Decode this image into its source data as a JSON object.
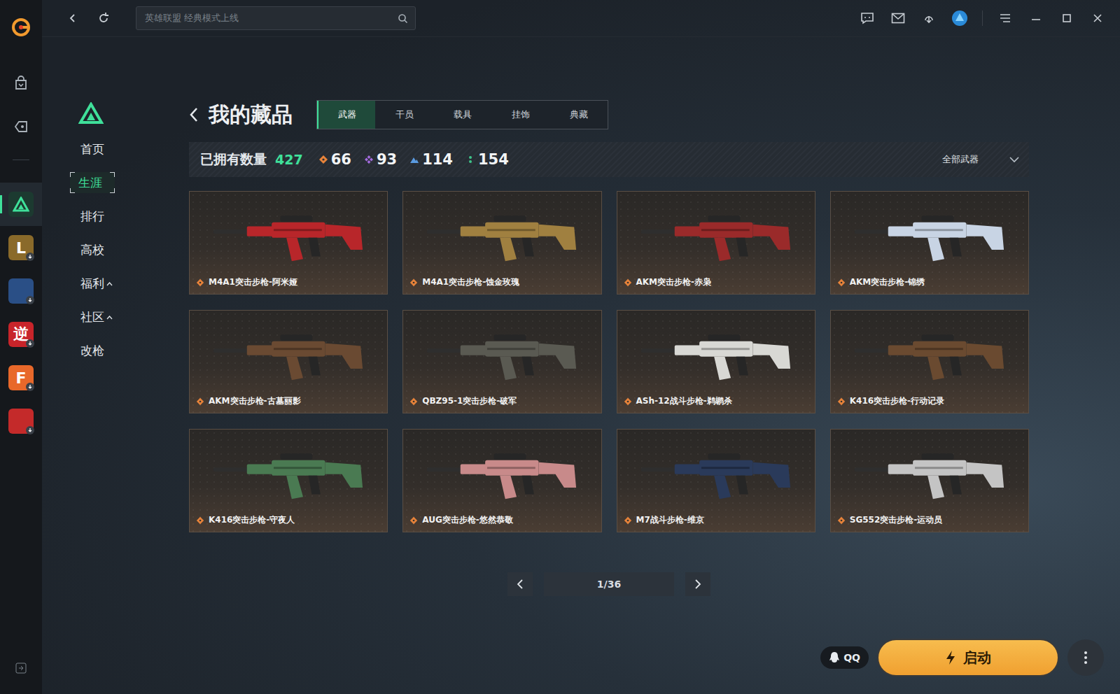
{
  "topbar": {
    "search_placeholder": "英雄联盟 经典模式上线"
  },
  "rail": {
    "games": [
      {
        "kind": "delta",
        "glyph": "",
        "color": "#1c3a30",
        "selected": true,
        "download": false
      },
      {
        "kind": "tile",
        "glyph": "L",
        "color": "#8a6a2a",
        "selected": false,
        "download": true
      },
      {
        "kind": "tile",
        "glyph": "",
        "color": "#2a4f86",
        "selected": false,
        "download": true
      },
      {
        "kind": "tile",
        "glyph": "逆",
        "color": "#c8242a",
        "selected": false,
        "download": true
      },
      {
        "kind": "tile",
        "glyph": "F",
        "color": "#e8682a",
        "selected": false,
        "download": true
      },
      {
        "kind": "tile",
        "glyph": "",
        "color": "#c42a2a",
        "selected": false,
        "download": true
      }
    ]
  },
  "sidebar": {
    "items": [
      {
        "label": "首页",
        "selected": false,
        "submenu": false
      },
      {
        "label": "生涯",
        "selected": true,
        "submenu": false
      },
      {
        "label": "排行",
        "selected": false,
        "submenu": false
      },
      {
        "label": "高校",
        "selected": false,
        "submenu": false
      },
      {
        "label": "福利",
        "selected": false,
        "submenu": true
      },
      {
        "label": "社区",
        "selected": false,
        "submenu": true
      },
      {
        "label": "改枪",
        "selected": false,
        "submenu": false
      }
    ]
  },
  "page": {
    "title": "我的藏品",
    "tabs": [
      {
        "label": "武器",
        "selected": true
      },
      {
        "label": "干员",
        "selected": false
      },
      {
        "label": "载具",
        "selected": false
      },
      {
        "label": "挂饰",
        "selected": false
      },
      {
        "label": "典藏",
        "selected": false
      }
    ],
    "owned_label": "已拥有数量",
    "owned_count": "427",
    "rarity_counts": [
      {
        "kind": "diamond",
        "count": "66",
        "color": "#e8833a"
      },
      {
        "kind": "cluster",
        "count": "93",
        "color": "#a46ce0"
      },
      {
        "kind": "peak",
        "count": "114",
        "color": "#5a9ae0"
      },
      {
        "kind": "dots",
        "count": "154",
        "color": "#3ec48a"
      }
    ],
    "filter": "全部武器"
  },
  "weapons": [
    {
      "name": "M4A1突击步枪-阿米娅",
      "rarity_color": "#e8833a",
      "color": "#b8262a"
    },
    {
      "name": "M4A1突击步枪-蚀金玫瑰",
      "rarity_color": "#e8833a",
      "color": "#a08040"
    },
    {
      "name": "AKM突击步枪-赤枭",
      "rarity_color": "#e8833a",
      "color": "#9a2a2a"
    },
    {
      "name": "AKM突击步枪-锦绣",
      "rarity_color": "#e8833a",
      "color": "#c8d4e4"
    },
    {
      "name": "AKM突击步枪-古墓丽影",
      "rarity_color": "#e8833a",
      "color": "#6a4a32"
    },
    {
      "name": "QBZ95-1突击步枪-破军",
      "rarity_color": "#e8833a",
      "color": "#5a5a52"
    },
    {
      "name": "ASh-12战斗步枪-鹈鹕杀",
      "rarity_color": "#e8833a",
      "color": "#d8d8d4"
    },
    {
      "name": "K416突击步枪-行动记录",
      "rarity_color": "#e8833a",
      "color": "#6a4a30"
    },
    {
      "name": "K416突击步枪-守夜人",
      "rarity_color": "#e8833a",
      "color": "#4a7a52"
    },
    {
      "name": "AUG突击步枪-悠然恭敬",
      "rarity_color": "#e8833a",
      "color": "#c88a8a"
    },
    {
      "name": "M7战斗步枪-维京",
      "rarity_color": "#e8833a",
      "color": "#2a3a5a"
    },
    {
      "name": "SG552突击步枪-运动员",
      "rarity_color": "#e8833a",
      "color": "#c4c4c4"
    }
  ],
  "pagination": {
    "page": "1/36"
  },
  "launch": {
    "qq": "QQ",
    "start": "启动"
  }
}
